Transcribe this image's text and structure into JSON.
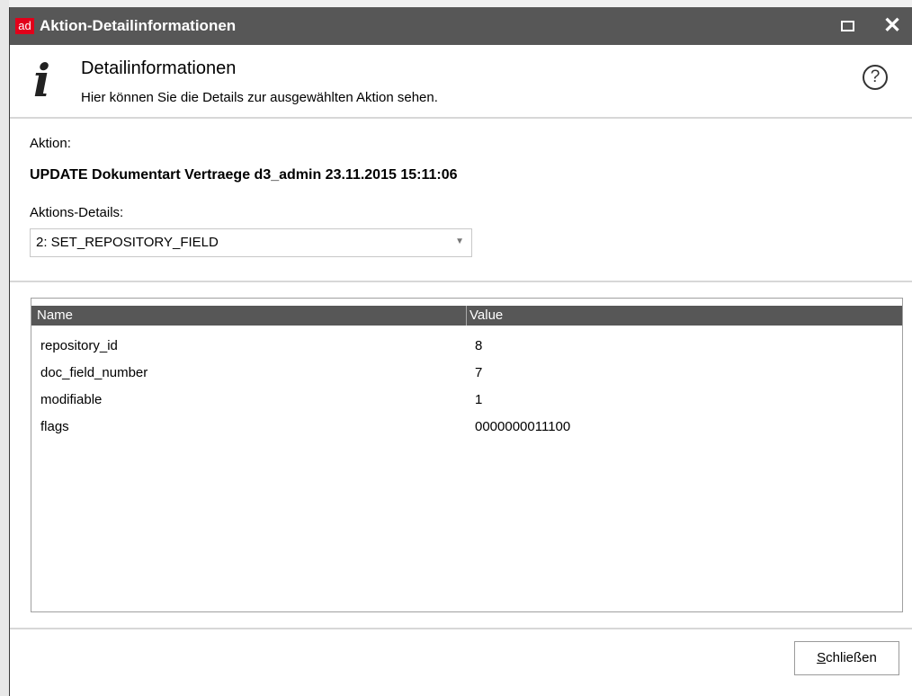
{
  "window": {
    "logo_text": "ad",
    "title": "Aktion-Detailinformationen",
    "close_glyph": "✕",
    "icons": {
      "maximize": "maximize-icon",
      "close": "close-icon"
    }
  },
  "header": {
    "icon_glyph": "i",
    "title": "Detailinformationen",
    "subtitle": "Hier können Sie die Details zur ausgewählten Aktion sehen.",
    "help_glyph": "?"
  },
  "form": {
    "action_label": "Aktion:",
    "action_value": "UPDATE Dokumentart Vertraege d3_admin 23.11.2015 15:11:06",
    "details_label": "Aktions-Details:",
    "details_selected": "2: SET_REPOSITORY_FIELD",
    "dropdown_glyph": "▼"
  },
  "table": {
    "columns": [
      "Name",
      "Value"
    ],
    "rows": [
      {
        "name": "repository_id",
        "value": "8"
      },
      {
        "name": "doc_field_number",
        "value": "7"
      },
      {
        "name": "modifiable",
        "value": "1"
      },
      {
        "name": "flags",
        "value": "0000000011100"
      }
    ]
  },
  "footer": {
    "close_first": "S",
    "close_rest": "chließen"
  }
}
